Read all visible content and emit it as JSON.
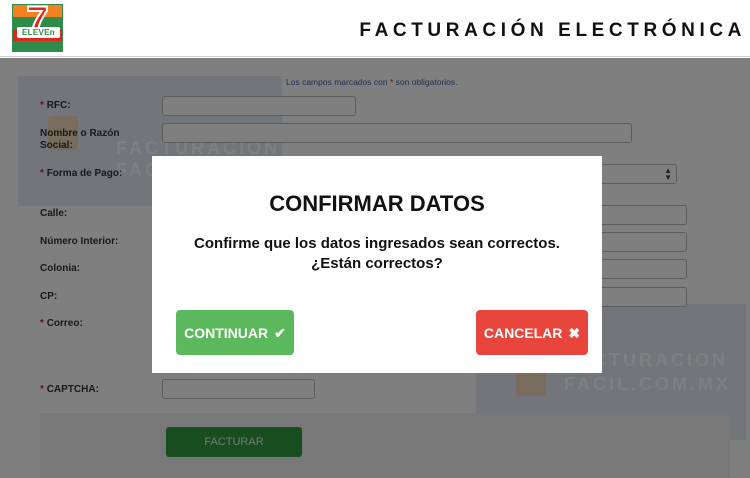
{
  "header": {
    "logo_text": "7 ELEVEn",
    "title": "FACTURACIÓN ELECTRÓNICA"
  },
  "form": {
    "required_note_prefix": "Los campos marcados con ",
    "required_star": "*",
    "required_note_suffix": " son obligatorios.",
    "fields": {
      "rfc": {
        "label": "RFC:",
        "required": true
      },
      "nombre": {
        "label": "Nombre o Razón Social:",
        "required": false
      },
      "forma_pago": {
        "label": "Forma de Pago:",
        "required": true
      },
      "calle": {
        "label": "Calle:",
        "required": false
      },
      "numero_interior": {
        "label": "Número Interior:",
        "required": false
      },
      "colonia": {
        "label": "Colonia:",
        "required": false
      },
      "cp": {
        "label": "CP:",
        "required": false
      },
      "correo": {
        "label": "Correo:",
        "required": true
      },
      "captcha": {
        "label": "CAPTCHA:",
        "required": true
      }
    },
    "watermark_line1": "FACTURACION",
    "watermark_line2": "FACIL.COM.MX",
    "submit_label": "FACTURAR"
  },
  "modal": {
    "title": "CONFIRMAR DATOS",
    "message_line1": "Confirme que los datos ingresados sean correctos.",
    "message_line2": "¿Están correctos?",
    "continue_label": "CONTINUAR",
    "continue_icon": "check-icon",
    "cancel_label": "CANCELAR",
    "cancel_icon": "close-icon"
  },
  "colors": {
    "continue": "#5cb85c",
    "cancel": "#e8453c",
    "facturar": "#2f9a3e",
    "logo_green": "#2e8b4a",
    "logo_red": "#e1251b",
    "logo_orange": "#f58220"
  }
}
